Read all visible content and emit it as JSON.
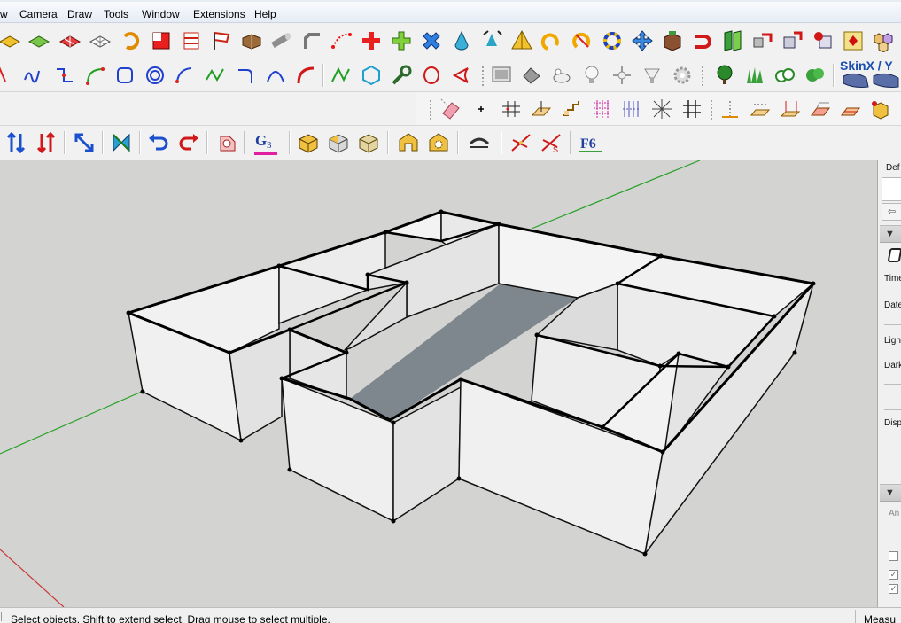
{
  "menu": {
    "items": [
      "w",
      "Camera",
      "Draw",
      "Tools",
      "Window",
      "Extensions",
      "Help"
    ]
  },
  "toolbar_row1": {
    "icons": [
      "select-icon",
      "paint-bucket-icon",
      "eraser-icon",
      "rectangle-icon",
      "circle-icon",
      "offset-icon",
      "arc-icon",
      "follow-me-icon",
      "move-icon",
      "rotate-icon",
      "scale-icon",
      "push-pull-icon",
      "tape-measure-icon",
      "dimension-icon",
      "protractor-icon",
      "text-icon",
      "axes-icon",
      "3d-text-icon",
      "orbit-icon",
      "pan-icon",
      "zoom-icon",
      "zoom-extents-icon",
      "previous-view-icon",
      "position-camera-icon",
      "walk-icon",
      "look-around-icon",
      "section-plane-icon",
      "add-location-icon",
      "toggle-terrain-icon",
      "photo-textures-icon"
    ]
  },
  "toolbar_row2": {
    "skin_label": "SkinX / Y"
  },
  "status": {
    "message": "Select objects. Shift to extend select. Drag mouse to select multiple.",
    "measurements_label": "Measu"
  },
  "tray": {
    "default_tray": "Def",
    "time_label": "Time",
    "date_label": "Date",
    "light_label": "Ligh",
    "dark_label": "Dark",
    "display_label": "Disp",
    "angle_label": "An"
  },
  "colors": {
    "viewport_bg": "#d3d3d1",
    "wall_face": "#ececec",
    "wall_shade": "#dcdcdc",
    "floor": "#7d878d",
    "edge": "#111111",
    "green_axis": "#2aa12a",
    "red_axis": "#c83a3a"
  },
  "model": {
    "description_free": true
  }
}
